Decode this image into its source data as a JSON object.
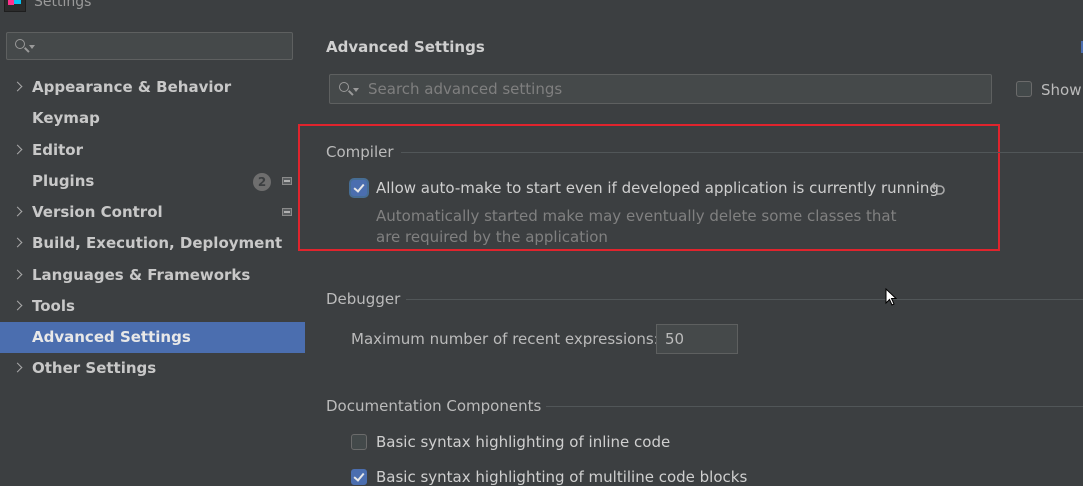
{
  "window": {
    "title": "Settings"
  },
  "sidebar": {
    "search": {
      "value": "",
      "placeholder": ""
    },
    "items": [
      {
        "label": "Appearance & Behavior",
        "expandable": true
      },
      {
        "label": "Keymap",
        "expandable": false
      },
      {
        "label": "Editor",
        "expandable": true
      },
      {
        "label": "Plugins",
        "expandable": false,
        "badge": "2"
      },
      {
        "label": "Version Control",
        "expandable": true
      },
      {
        "label": "Build, Execution, Deployment",
        "expandable": true
      },
      {
        "label": "Languages & Frameworks",
        "expandable": true
      },
      {
        "label": "Tools",
        "expandable": true
      },
      {
        "label": "Advanced Settings",
        "expandable": false,
        "selected": true
      },
      {
        "label": "Other Settings",
        "expandable": true
      }
    ]
  },
  "main": {
    "title": "Advanced Settings",
    "search": {
      "placeholder": "Search advanced settings",
      "value": ""
    },
    "show_modified_label": "Show",
    "sections": {
      "compiler": {
        "title": "Compiler",
        "option_label": "Allow auto-make to start even if developed application is currently running",
        "option_checked": true,
        "desc_line1": "Automatically started make may eventually delete some classes that",
        "desc_line2": "are required by the application"
      },
      "debugger": {
        "title": "Debugger",
        "field_label": "Maximum number of recent expressions:",
        "field_value": "50"
      },
      "documentation": {
        "title": "Documentation Components",
        "opt1_label": "Basic syntax highlighting of inline code",
        "opt1_checked": false,
        "opt2_label": "Basic syntax highlighting of multiline code blocks",
        "opt2_checked": true
      }
    }
  },
  "colors": {
    "selection": "#4b6eaf",
    "highlight_frame": "#e0242d",
    "background": "#3c3f41"
  }
}
